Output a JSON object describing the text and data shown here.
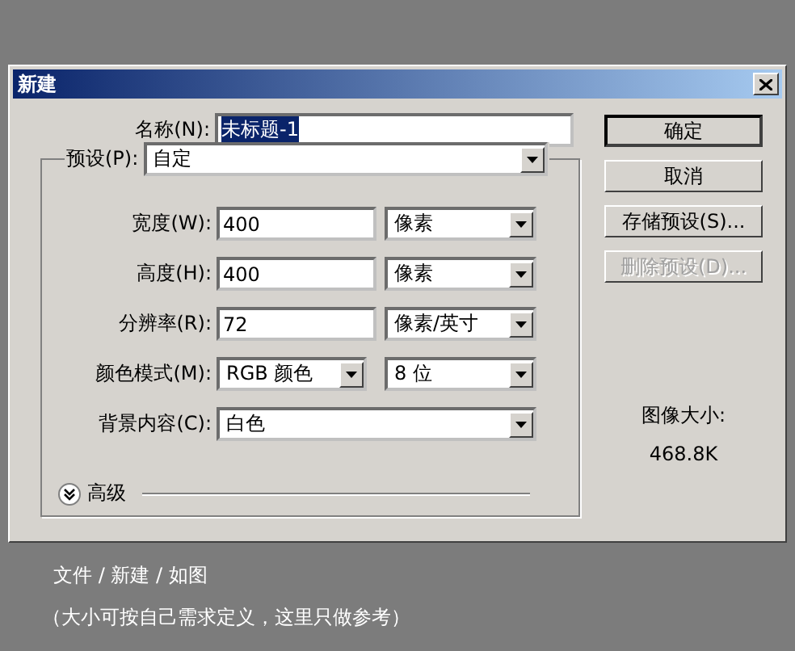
{
  "window": {
    "title": "新建"
  },
  "name_field": {
    "label": "名称(N):",
    "value": "未标题-1",
    "selected": true
  },
  "preset": {
    "label": "预设(P):",
    "value": "自定"
  },
  "rows": [
    {
      "kind": "input_unit",
      "label": "宽度(W):",
      "value": "400",
      "unit": "像素"
    },
    {
      "kind": "input_unit",
      "label": "高度(H):",
      "value": "400",
      "unit": "像素"
    },
    {
      "kind": "input_unit",
      "label": "分辨率(R):",
      "value": "72",
      "unit": "像素/英寸"
    },
    {
      "kind": "select_pair",
      "label": "颜色模式(M):",
      "value": "RGB 颜色",
      "unit": "8 位"
    },
    {
      "kind": "select",
      "label": "背景内容(C):",
      "value": "白色"
    }
  ],
  "advanced": {
    "label": "高级",
    "expanded": false
  },
  "buttons": [
    {
      "label": "确定",
      "default": true,
      "disabled": false
    },
    {
      "label": "取消",
      "default": false,
      "disabled": false
    },
    {
      "label": "存储预设(S)...",
      "default": false,
      "disabled": false
    },
    {
      "label": "删除预设(D)...",
      "default": false,
      "disabled": true
    }
  ],
  "image_size": {
    "label": "图像大小:",
    "value": "468.8K"
  },
  "caption": [
    "文件 / 新建 / 如图",
    "（大小可按自己需求定义，这里只做参考）"
  ]
}
